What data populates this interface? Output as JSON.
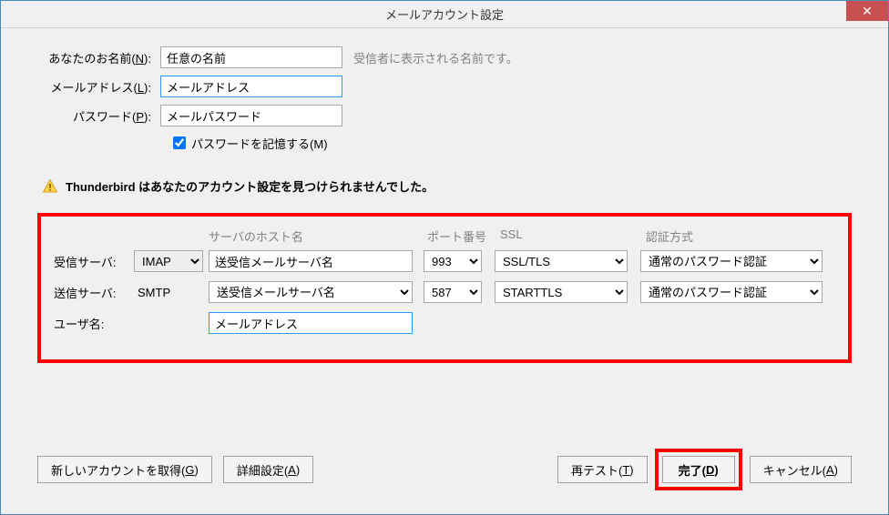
{
  "window": {
    "title": "メールアカウント設定",
    "close_icon": "✕"
  },
  "form": {
    "name_label": "あなたのお名前(N):",
    "name_value": "任意の名前",
    "name_hint": "受信者に表示される名前です。",
    "email_label": "メールアドレス(L):",
    "email_value": "メールアドレス",
    "password_label": "パスワード(P):",
    "password_value": "メールパスワード",
    "remember_label": "パスワードを記憶する(M)"
  },
  "warning": {
    "text": "Thunderbird はあなたのアカウント設定を見つけられませんでした。"
  },
  "headers": {
    "host": "サーバのホスト名",
    "port": "ポート番号",
    "ssl": "SSL",
    "auth": "認証方式"
  },
  "incoming": {
    "label": "受信サーバ:",
    "protocol": "IMAP",
    "host": "送受信メールサーバ名",
    "port": "993",
    "ssl": "SSL/TLS",
    "auth": "通常のパスワード認証"
  },
  "outgoing": {
    "label": "送信サーバ:",
    "protocol": "SMTP",
    "host": "送受信メールサーバ名",
    "port": "587",
    "ssl": "STARTTLS",
    "auth": "通常のパスワード認証"
  },
  "username": {
    "label": "ユーザ名:",
    "value": "メールアドレス"
  },
  "buttons": {
    "new_account": "新しいアカウントを取得(G)",
    "advanced": "詳細設定(A)",
    "retest": "再テスト(T)",
    "done": "完了(D)",
    "cancel": "キャンセル(A)"
  }
}
